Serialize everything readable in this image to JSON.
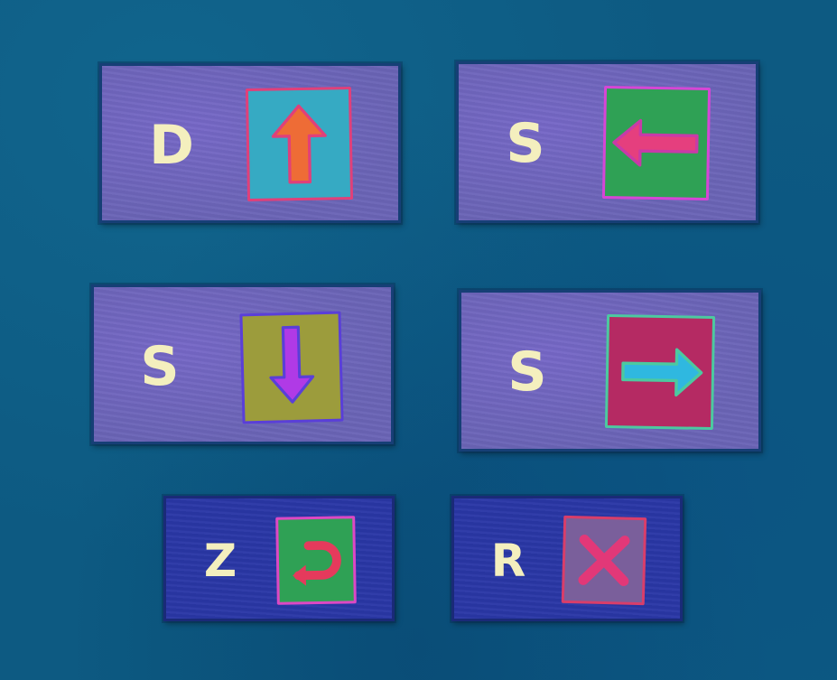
{
  "controls": [
    {
      "id": "up",
      "key": "D",
      "icon": "arrow-up-icon",
      "tile_color": "#36aac3",
      "tile_border": "#e0407a",
      "symbol_color": "#ee6c36"
    },
    {
      "id": "left",
      "key": "S",
      "icon": "arrow-left-icon",
      "tile_color": "#2fa155",
      "tile_border": "#d646d6",
      "symbol_color": "#e53f7e"
    },
    {
      "id": "down",
      "key": "S",
      "icon": "arrow-down-icon",
      "tile_color": "#9c9c3c",
      "tile_border": "#5a3fd8",
      "symbol_color": "#b03ae6"
    },
    {
      "id": "right",
      "key": "S",
      "icon": "arrow-right-icon",
      "tile_color": "#b52a63",
      "tile_border": "#4cc9a0",
      "symbol_color": "#2fb8e0"
    },
    {
      "id": "undo",
      "key": "Z",
      "icon": "undo-icon",
      "tile_color": "#2fa155",
      "tile_border": "#dd48c4",
      "symbol_color": "#e53a5c"
    },
    {
      "id": "reset",
      "key": "R",
      "icon": "close-x-icon",
      "tile_color": "#7a5f9b",
      "tile_border": "#d83e6a",
      "symbol_color": "#e23878"
    }
  ],
  "colors": {
    "background": "#0d5a82",
    "panel": "#6a64b6",
    "panel_small": "#2a37a6",
    "key_text": "#f4efbe"
  }
}
